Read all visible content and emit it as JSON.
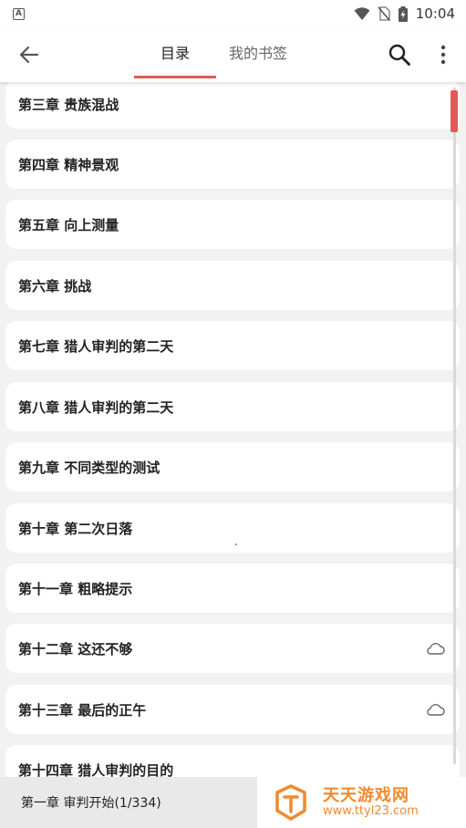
{
  "status_bar": {
    "time": "10:04",
    "notification_badge": "A"
  },
  "app_bar": {
    "tabs": [
      {
        "label": "目录",
        "active": true
      },
      {
        "label": "我的书签",
        "active": false
      }
    ],
    "accent_color": "#e05b57"
  },
  "chapters": [
    {
      "title": "第三章 贵族混战",
      "cloud": false
    },
    {
      "title": "第四章 精神景观",
      "cloud": false
    },
    {
      "title": "第五章 向上测量",
      "cloud": false
    },
    {
      "title": "第六章 挑战",
      "cloud": false
    },
    {
      "title": "第七章 猎人审判的第二天",
      "cloud": false
    },
    {
      "title": "第八章 猎人审判的第二天",
      "cloud": false
    },
    {
      "title": "第九章 不同类型的测试",
      "cloud": false
    },
    {
      "title": "第十章 第二次日落",
      "cloud": false
    },
    {
      "title": "第十一章 粗略提示",
      "cloud": false
    },
    {
      "title": "第十二章 这还不够",
      "cloud": true
    },
    {
      "title": "第十三章 最后的正午",
      "cloud": true
    },
    {
      "title": "第十四章 猎人审判的目的",
      "cloud": false
    }
  ],
  "current_chapter": "第一章 审判开始(1/334)",
  "watermark": {
    "title": "天天游戏网",
    "url": "www.ttyl23.com"
  }
}
